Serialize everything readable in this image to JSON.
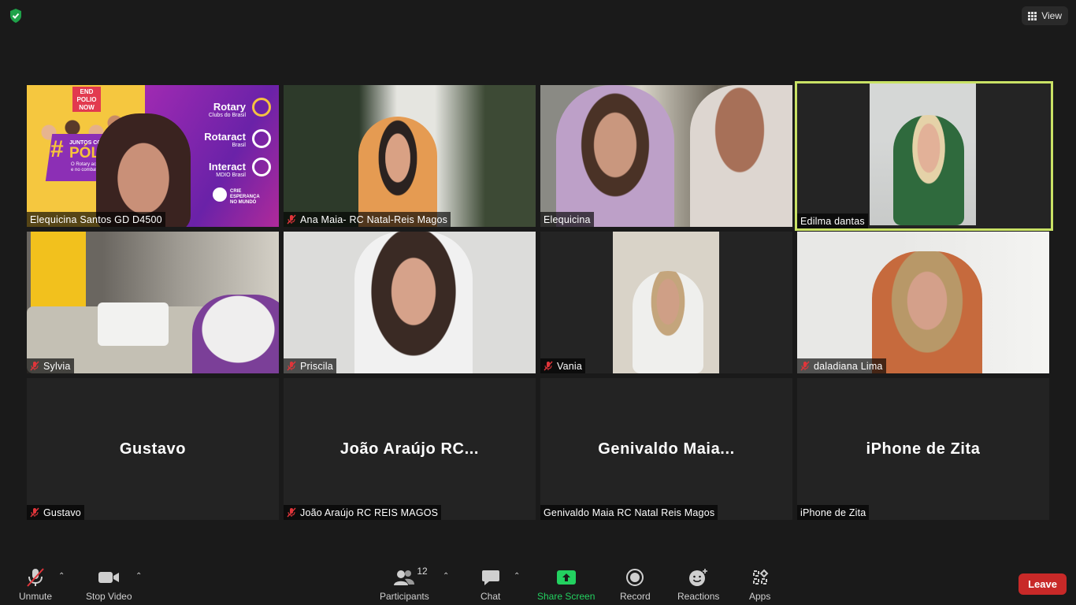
{
  "topbar": {
    "view_label": "View"
  },
  "participants": [
    {
      "name": "Elequicina Santos GD D4500",
      "muted": false,
      "video": true
    },
    {
      "name": "Ana Maia- RC Natal-Reis Magos",
      "muted": true,
      "video": true
    },
    {
      "name": "Elequicina",
      "muted": false,
      "video": true
    },
    {
      "name": "Edilma dantas",
      "muted": false,
      "video": true,
      "active_speaker": true
    },
    {
      "name": "Sylvia",
      "muted": true,
      "video": true
    },
    {
      "name": "Priscila",
      "muted": true,
      "video": true
    },
    {
      "name": "Vania",
      "muted": true,
      "video": true
    },
    {
      "name": "daladiana Lima",
      "muted": true,
      "video": true
    },
    {
      "name": "Gustavo",
      "display": "Gustavo",
      "muted": true,
      "video": false
    },
    {
      "name": "João Araújo RC REIS MAGOS",
      "display": "João Araújo RC...",
      "muted": true,
      "video": false
    },
    {
      "name": "Genivaldo Maia RC Natal Reis Magos",
      "display": "Genivaldo Maia...",
      "muted": false,
      "video": false
    },
    {
      "name": "iPhone de Zita",
      "display": "iPhone de Zita",
      "muted": false,
      "video": false
    }
  ],
  "poster": {
    "end_polio": "END POLIO NOW",
    "hashtag": "#",
    "juntos": "JUNTOS CONTRA",
    "polio": "PÓLIO",
    "rotary": "Rotary",
    "rotary_sub": "Clubs do Brasil",
    "rotaract": "Rotaract",
    "rotaract_sub": "Brasil",
    "interact": "Interact",
    "interact_sub": "MDIO Brasil",
    "slogan": "CRIE ESPERANÇA NO MUNDO",
    "copy": "O Rotary acredita no poder d e no combate à paral"
  },
  "toolbar": {
    "unmute": "Unmute",
    "stop_video": "Stop Video",
    "participants": "Participants",
    "participants_count": "12",
    "chat": "Chat",
    "share_screen": "Share Screen",
    "record": "Record",
    "reactions": "Reactions",
    "apps": "Apps",
    "leave": "Leave"
  },
  "colors": {
    "active_border": "#c9e265",
    "share_green": "#23d160",
    "leave_red": "#c82928",
    "mute_red": "#e0353a"
  }
}
